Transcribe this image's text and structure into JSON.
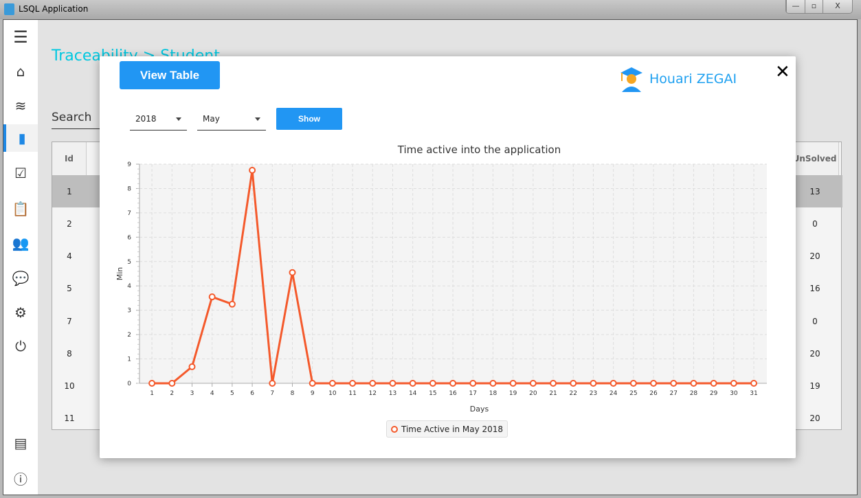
{
  "window": {
    "title": "LSQL Application",
    "buttons": [
      "—",
      "▫",
      "X"
    ]
  },
  "sidebar": {
    "items": [
      "menu",
      "home",
      "wifi",
      "chart",
      "checklist",
      "clipboard",
      "users",
      "chat",
      "settings",
      "power",
      "dashboard",
      "info"
    ]
  },
  "breadcrumb": "Traceability > Student",
  "search_label": "Search",
  "table": {
    "headers": [
      "Id",
      "UnSolved"
    ],
    "rows": [
      [
        "1",
        "13"
      ],
      [
        "2",
        "0"
      ],
      [
        "4",
        "20"
      ],
      [
        "5",
        "16"
      ],
      [
        "7",
        "0"
      ],
      [
        "8",
        "20"
      ],
      [
        "10",
        "19"
      ],
      [
        "11",
        "20"
      ]
    ]
  },
  "modal": {
    "view_table": "View Table",
    "user_name": "Houari ZEGAI",
    "close": "✕",
    "year": "2018",
    "month": "May",
    "show": "Show"
  },
  "colors": {
    "accent": "#2196f3",
    "series": "#f4592b"
  },
  "chart_data": {
    "type": "line",
    "title": "Time active into the application",
    "xlabel": "Days",
    "ylabel": "Min",
    "x": [
      1,
      2,
      3,
      4,
      5,
      6,
      7,
      8,
      9,
      10,
      11,
      12,
      13,
      14,
      15,
      16,
      17,
      18,
      19,
      20,
      21,
      22,
      23,
      24,
      25,
      26,
      27,
      28,
      29,
      30,
      31
    ],
    "series": [
      {
        "name": "Time Active in May 2018",
        "values": [
          0,
          0,
          0.68,
          3.55,
          3.25,
          8.75,
          0,
          4.55,
          0,
          0,
          0,
          0,
          0,
          0,
          0,
          0,
          0,
          0,
          0,
          0,
          0,
          0,
          0,
          0,
          0,
          0,
          0,
          0,
          0,
          0,
          0
        ]
      }
    ],
    "ylim": [
      0,
      9
    ],
    "yticks": [
      0,
      1,
      2,
      3,
      4,
      5,
      6,
      7,
      8,
      9
    ],
    "grid": true,
    "legend": "bottom"
  }
}
